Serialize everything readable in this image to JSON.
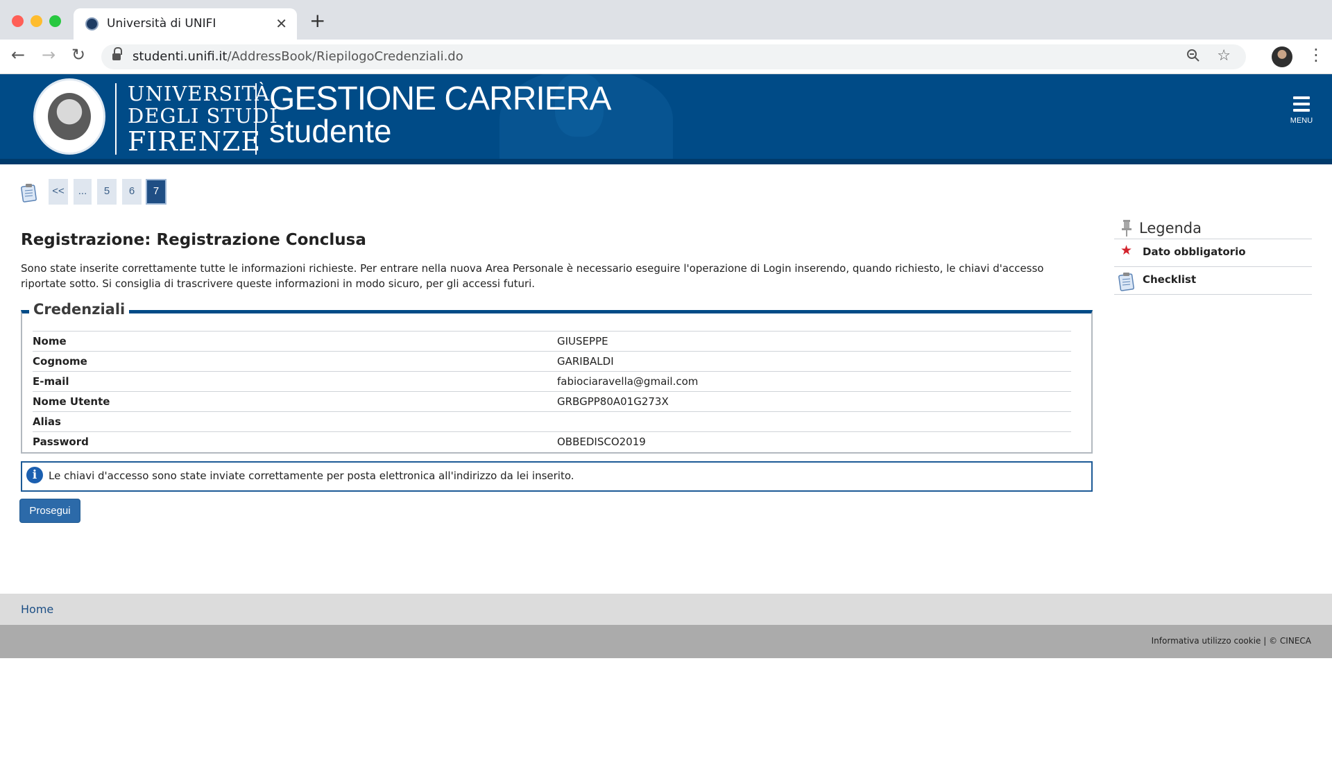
{
  "browser": {
    "tab_title": "Università di UNIFI",
    "url_host": "studenti.unifi.it",
    "url_path": "/AddressBook/RiepilogoCredenziali.do",
    "icons": [
      "back-icon",
      "forward-icon",
      "reload-icon",
      "lock-icon",
      "zoom-icon",
      "bookmark-star-icon",
      "profile-avatar",
      "more-menu-icon"
    ]
  },
  "header": {
    "uni_line1": "UNIVERSITÀ",
    "uni_line2": "DEGLI STUDI",
    "uni_line3": "FIRENZE",
    "brand_title": "GESTIONE CARRIERA",
    "brand_subtitle": "studente",
    "menu_label": "MENU",
    "colors": {
      "banner": "#004b87",
      "accent": "#2c6aa9"
    }
  },
  "steps": {
    "items": [
      "<<",
      "...",
      "5",
      "6",
      "7"
    ],
    "active": "7"
  },
  "main": {
    "title": "Registrazione: Registrazione Conclusa",
    "intro": "Sono state inserite correttamente tutte le informazioni richieste. Per entrare nella nuova Area Personale è necessario eseguire l'operazione di Login inserendo, quando richiesto, le chiavi d'accesso riportate sotto. Si consiglia di trascrivere queste informazioni in modo sicuro, per gli accessi futuri.",
    "credentials": {
      "legend": "Credenziali",
      "rows": [
        {
          "label": "Nome",
          "value": "GIUSEPPE"
        },
        {
          "label": "Cognome",
          "value": "GARIBALDI"
        },
        {
          "label": "E-mail",
          "value": "fabiociaravella@gmail.com"
        },
        {
          "label": "Nome Utente",
          "value": "GRBGPP80A01G273X"
        },
        {
          "label": "Alias",
          "value": ""
        },
        {
          "label": "Password",
          "value": "OBBEDISCO2019"
        }
      ]
    },
    "info_icon_glyph": "i",
    "info_message": "Le chiavi d'accesso sono state inviate correttamente per posta elettronica all'indirizzo da lei inserito.",
    "button_label": "Prosegui"
  },
  "legend": {
    "title": "Legenda",
    "items": [
      {
        "icon": "required-star-icon",
        "glyph": "★",
        "label": "Dato obbligatorio"
      },
      {
        "icon": "checklist-icon",
        "label": "Checklist"
      }
    ]
  },
  "footer": {
    "home_link": "Home",
    "note": "Informativa utilizzo cookie | © CINECA"
  }
}
